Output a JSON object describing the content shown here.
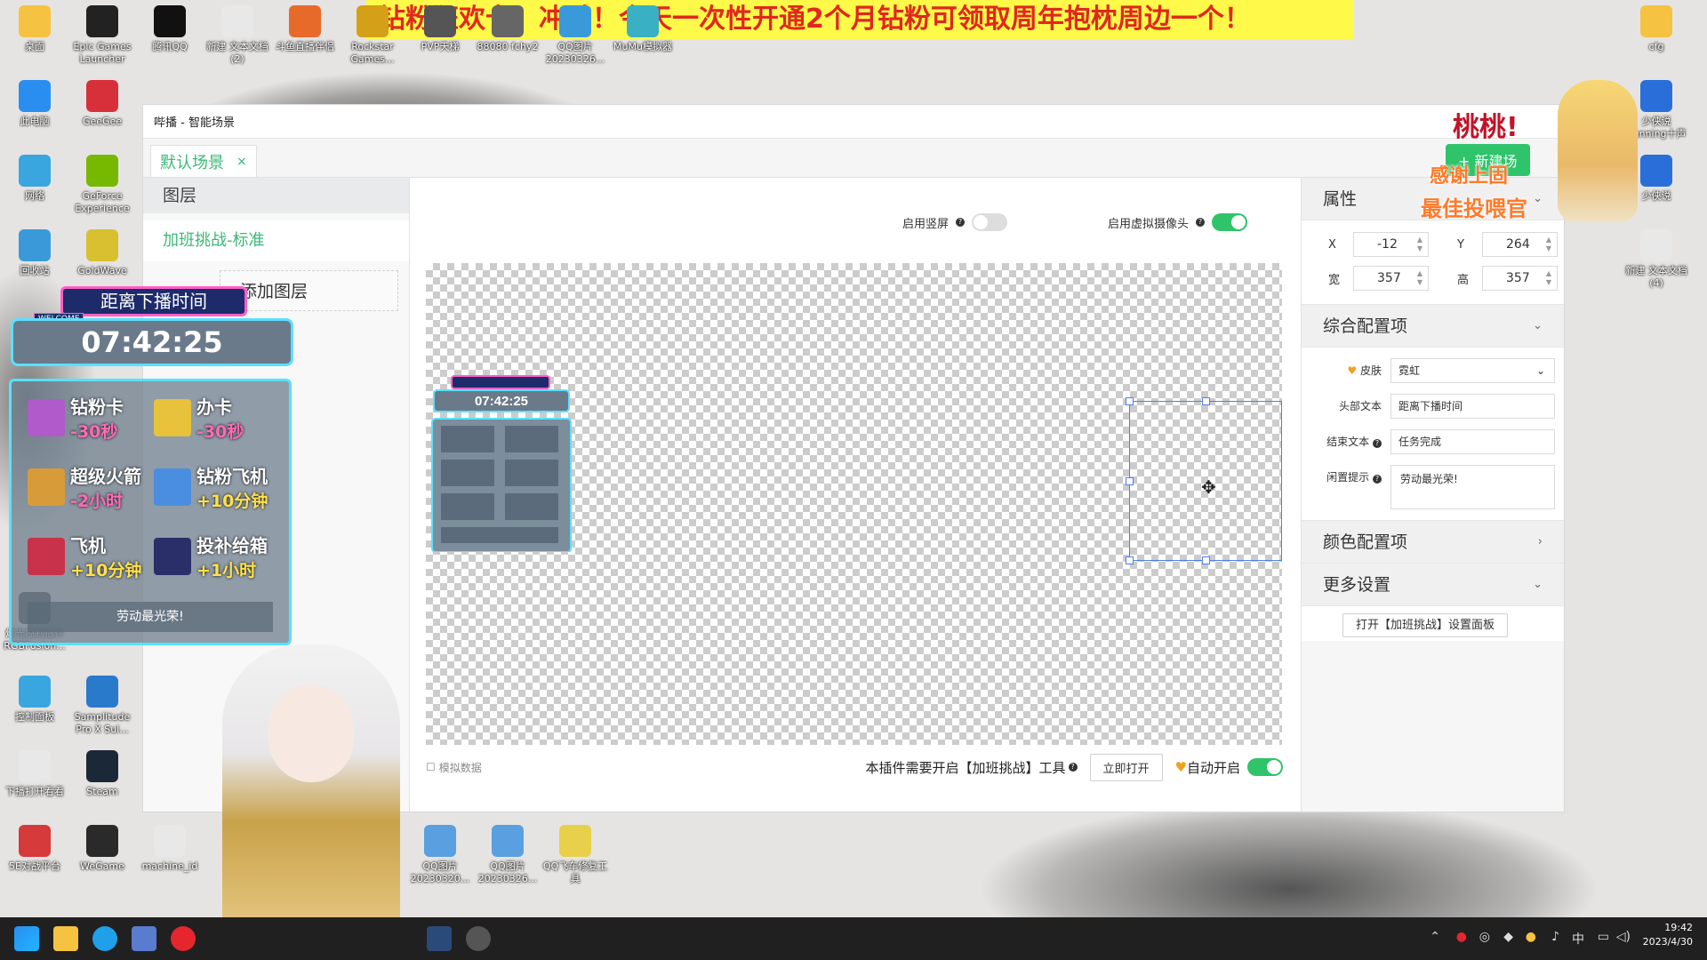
{
  "banner": {
    "text": "钻粉狂欢卡！冲鸭！今天一次性开通2个月钻粉可领取周年抱枕周边一个！"
  },
  "desktop": {
    "icons": [
      {
        "label": "桌面",
        "icon": "folder-icon"
      },
      {
        "label": "Epic Games Launcher",
        "icon": "epic-icon"
      },
      {
        "label": "腾讯QQ",
        "icon": "qq-icon"
      },
      {
        "label": "新建 文本文档 (2)",
        "icon": "text-file-icon"
      },
      {
        "label": "斗鱼直播伴侣",
        "icon": "douyu-icon"
      },
      {
        "label": "Rockstar Games...",
        "icon": "rockstar-icon"
      },
      {
        "label": "PVP天梯",
        "icon": "pvp-icon"
      },
      {
        "label": "88080 fchy2",
        "icon": "app-icon"
      },
      {
        "label": "QQ图片 20230326...",
        "icon": "image-icon"
      },
      {
        "label": "MuMu模拟器",
        "icon": "mumu-icon"
      },
      {
        "label": "cfg",
        "icon": "folder-icon"
      },
      {
        "label": "此电脑",
        "icon": "computer-icon"
      },
      {
        "label": "GeeGee",
        "icon": "geegee-icon"
      },
      {
        "label": "网络",
        "icon": "network-icon"
      },
      {
        "label": "GeForce Experience",
        "icon": "nvidia-icon"
      },
      {
        "label": "回收站",
        "icon": "recycle-bin-icon"
      },
      {
        "label": "GoldWave",
        "icon": "goldwave-icon"
      },
      {
        "label": "少侠说 Running十声",
        "icon": "audio-file-icon"
      },
      {
        "label": "少侠说",
        "icon": "audio-file-icon"
      },
      {
        "label": "新建 文本文档 (4)",
        "icon": "text-file-icon"
      },
      {
        "label": "控制面板",
        "icon": "control-panel-icon"
      },
      {
        "label": "Samplitude Pro X Sui...",
        "icon": "samplitude-icon"
      },
      {
        "label": "下播打开看看",
        "icon": "text-file-icon"
      },
      {
        "label": "Steam",
        "icon": "steam-icon"
      },
      {
        "label": "5E对战平台",
        "icon": "5e-icon"
      },
      {
        "label": "WeGame",
        "icon": "wegame-icon"
      },
      {
        "label": "machine_id",
        "icon": "text-file-icon"
      },
      {
        "label": "QQ图片 20230320...",
        "icon": "image-icon"
      },
      {
        "label": "QQ图片 20230326...",
        "icon": "image-icon"
      },
      {
        "label": "QQ飞车修复工具",
        "icon": "qqspeed-icon"
      },
      {
        "label": "灯光控制插件 RGBFusion...",
        "icon": "rgb-icon"
      }
    ]
  },
  "window": {
    "title": "哔播 - 智能场景",
    "tab": {
      "label": "默认场景",
      "close": "×"
    },
    "layers": {
      "header": "图层",
      "items": [
        "加班挑战-标准"
      ],
      "add_label": "添加图层"
    },
    "toggles": {
      "vertical_label": "启用竖屏",
      "vertical_on": false,
      "camera_label": "启用虚拟摄像头",
      "camera_on": true
    },
    "bottom": {
      "simulate_label": "模拟数据",
      "notice": "本插件需要开启【加班挑战】工具",
      "open_now": "立即打开",
      "auto_open_label": "自动开启",
      "auto_open_on": true
    },
    "properties": {
      "header": "属性",
      "x_label": "X",
      "x": "-12",
      "y_label": "Y",
      "y": "264",
      "w_label": "宽",
      "w": "357",
      "h_label": "高",
      "h": "357"
    },
    "config": {
      "header": "综合配置项",
      "skin_label": "皮肤",
      "skin_value": "霓虹",
      "head_text_label": "头部文本",
      "head_text_value": "距离下播时间",
      "end_text_label": "结束文本",
      "end_text_value": "任务完成",
      "idle_label": "闲置提示",
      "idle_value": "劳动最光荣!"
    },
    "color_config": {
      "header": "颜色配置项"
    },
    "more_settings": {
      "header": "更多设置",
      "open_panel": "打开【加班挑战】设置面板"
    },
    "new_scene": "+ 新建场"
  },
  "overlay": {
    "head": "距离下播时间",
    "welcome": "WELCOME",
    "timer": "07:42:25",
    "items": [
      {
        "name": "钻粉卡",
        "effect": "-30秒"
      },
      {
        "name": "办卡",
        "effect": "-30秒"
      },
      {
        "name": "超级火箭",
        "effect": "-2小时"
      },
      {
        "name": "钻粉飞机",
        "effect": "+10分钟"
      },
      {
        "name": "飞机",
        "effect": "+10分钟"
      },
      {
        "name": "投补给箱",
        "effect": "+1小时"
      }
    ],
    "footer": "劳动最光荣!"
  },
  "sticker": {
    "line1": "桃桃!",
    "line2": "感谢上固",
    "line3": "最佳投喂官"
  },
  "tray": {
    "time": "19:42",
    "date": "2023/4/30",
    "ime": "中"
  },
  "colors": {
    "accent": "#3cb878",
    "switch_on": "#2fc36a",
    "banner_bg": "#fff94a",
    "banner_text": "#e0281e",
    "neon_cyan": "#59e1ff",
    "neon_pink": "#ff5fc8"
  }
}
